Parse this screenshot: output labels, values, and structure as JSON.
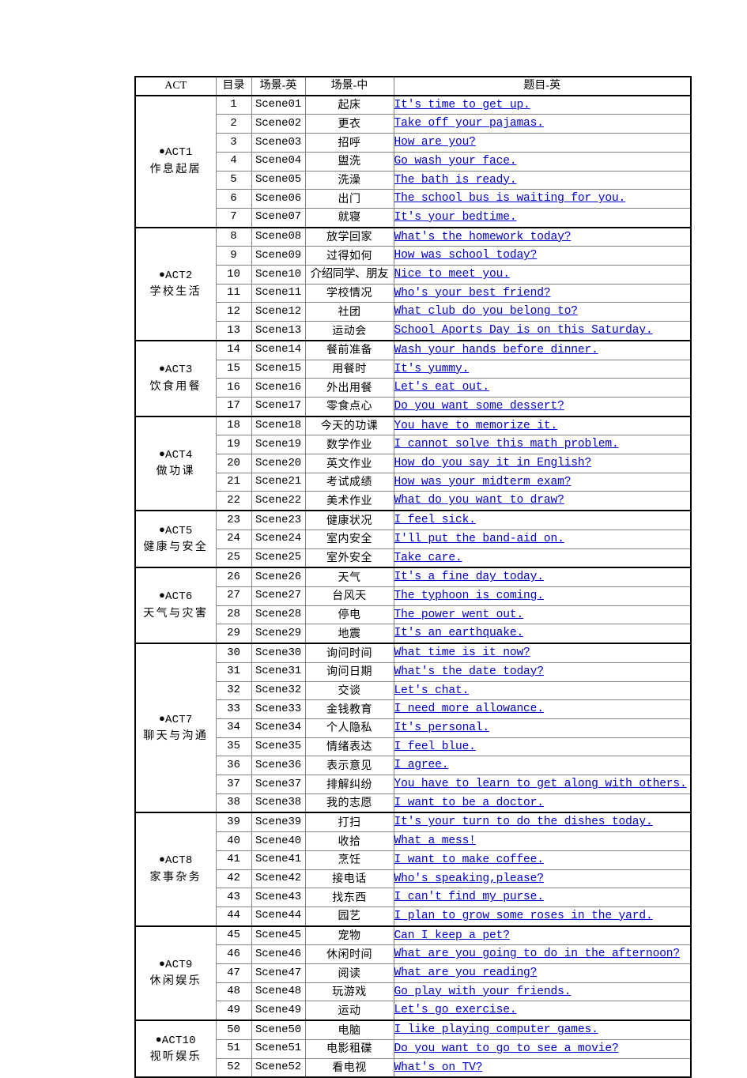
{
  "table": {
    "headers": {
      "act": "ACT",
      "index": "目录",
      "scene_en": "场景-英",
      "scene_zh": "场景-中",
      "title_en": "题目-英"
    },
    "groups": [
      {
        "code": "ACT1",
        "name": "作息起居",
        "rows": [
          {
            "index": "1",
            "scene_en": "Scene01",
            "scene_zh": "起床",
            "title_en": "It's time to get up."
          },
          {
            "index": "2",
            "scene_en": "Scene02",
            "scene_zh": "更衣",
            "title_en": "Take off your pajamas."
          },
          {
            "index": "3",
            "scene_en": "Scene03",
            "scene_zh": "招呼",
            "title_en": "How are you?"
          },
          {
            "index": "4",
            "scene_en": "Scene04",
            "scene_zh": "盥洗",
            "title_en": "Go wash your face."
          },
          {
            "index": "5",
            "scene_en": "Scene05",
            "scene_zh": "洗澡",
            "title_en": "The bath is ready."
          },
          {
            "index": "6",
            "scene_en": "Scene06",
            "scene_zh": "出门",
            "title_en": "The school bus is waiting for you."
          },
          {
            "index": "7",
            "scene_en": "Scene07",
            "scene_zh": "就寝",
            "title_en": "It's your bedtime."
          }
        ]
      },
      {
        "code": "ACT2",
        "name": "学校生活",
        "rows": [
          {
            "index": "8",
            "scene_en": "Scene08",
            "scene_zh": "放学回家",
            "title_en": "What's the homework today?"
          },
          {
            "index": "9",
            "scene_en": "Scene09",
            "scene_zh": "过得如何",
            "title_en": "How was school today?"
          },
          {
            "index": "10",
            "scene_en": "Scene10",
            "scene_zh": "介绍同学、朋友",
            "tight": true,
            "title_en": "Nice to meet you."
          },
          {
            "index": "11",
            "scene_en": "Scene11",
            "scene_zh": "学校情况",
            "title_en": "Who's your best friend?"
          },
          {
            "index": "12",
            "scene_en": "Scene12",
            "scene_zh": "社团",
            "title_en": "What club do you belong to?"
          },
          {
            "index": "13",
            "scene_en": "Scene13",
            "scene_zh": "运动会",
            "title_en": "School Aports Day is on this Saturday."
          }
        ]
      },
      {
        "code": "ACT3",
        "name": "饮食用餐",
        "rows": [
          {
            "index": "14",
            "scene_en": "Scene14",
            "scene_zh": "餐前准备",
            "title_en": "Wash your hands before dinner."
          },
          {
            "index": "15",
            "scene_en": "Scene15",
            "scene_zh": "用餐时",
            "title_en": "It's yummy."
          },
          {
            "index": "16",
            "scene_en": "Scene16",
            "scene_zh": "外出用餐",
            "title_en": "Let's eat out."
          },
          {
            "index": "17",
            "scene_en": "Scene17",
            "scene_zh": "零食点心",
            "title_en": "Do you want some dessert?"
          }
        ]
      },
      {
        "code": "ACT4",
        "name": "做功课",
        "rows": [
          {
            "index": "18",
            "scene_en": "Scene18",
            "scene_zh": "今天的功课",
            "title_en": "You have to memorize it."
          },
          {
            "index": "19",
            "scene_en": "Scene19",
            "scene_zh": "数学作业",
            "title_en": "I cannot solve this math problem."
          },
          {
            "index": "20",
            "scene_en": "Scene20",
            "scene_zh": "英文作业",
            "title_en": "How do you say it in English?"
          },
          {
            "index": "21",
            "scene_en": "Scene21",
            "scene_zh": "考试成绩",
            "title_en": "How was your midterm exam?"
          },
          {
            "index": "22",
            "scene_en": "Scene22",
            "scene_zh": "美术作业",
            "title_en": "What do you want to draw?"
          }
        ]
      },
      {
        "code": "ACT5",
        "name": "健康与安全",
        "rows": [
          {
            "index": "23",
            "scene_en": "Scene23",
            "scene_zh": "健康状况",
            "title_en": "I feel sick."
          },
          {
            "index": "24",
            "scene_en": "Scene24",
            "scene_zh": "室内安全",
            "title_en": "I'll put the band-aid on."
          },
          {
            "index": "25",
            "scene_en": "Scene25",
            "scene_zh": "室外安全",
            "title_en": "Take care."
          }
        ]
      },
      {
        "code": "ACT6",
        "name": "天气与灾害",
        "rows": [
          {
            "index": "26",
            "scene_en": "Scene26",
            "scene_zh": "天气",
            "title_en": "It's a fine day today."
          },
          {
            "index": "27",
            "scene_en": "Scene27",
            "scene_zh": "台风天",
            "title_en": "The typhoon is coming."
          },
          {
            "index": "28",
            "scene_en": "Scene28",
            "scene_zh": "停电",
            "title_en": "The power went out."
          },
          {
            "index": "29",
            "scene_en": "Scene29",
            "scene_zh": "地震",
            "title_en": "It's an earthquake."
          }
        ]
      },
      {
        "code": "ACT7",
        "name": "聊天与沟通",
        "rows": [
          {
            "index": "30",
            "scene_en": "Scene30",
            "scene_zh": "询问时间",
            "title_en": "What time is it now?"
          },
          {
            "index": "31",
            "scene_en": "Scene31",
            "scene_zh": "询问日期",
            "title_en": "What's the date today?"
          },
          {
            "index": "32",
            "scene_en": "Scene32",
            "scene_zh": "交谈",
            "title_en": "Let's chat."
          },
          {
            "index": "33",
            "scene_en": "Scene33",
            "scene_zh": "金钱教育",
            "title_en": "I need more allowance."
          },
          {
            "index": "34",
            "scene_en": "Scene34",
            "scene_zh": "个人隐私",
            "title_en": "It's personal."
          },
          {
            "index": "35",
            "scene_en": "Scene35",
            "scene_zh": "情绪表达",
            "title_en": "I feel blue."
          },
          {
            "index": "36",
            "scene_en": "Scene36",
            "scene_zh": "表示意见",
            "title_en": "I agree."
          },
          {
            "index": "37",
            "scene_en": "Scene37",
            "scene_zh": "排解纠纷",
            "title_en": "You have to learn to get along with others."
          },
          {
            "index": "38",
            "scene_en": "Scene38",
            "scene_zh": "我的志愿",
            "title_en": "I want to be a doctor."
          }
        ]
      },
      {
        "code": "ACT8",
        "name": "家事杂务",
        "rows": [
          {
            "index": "39",
            "scene_en": "Scene39",
            "scene_zh": "打扫",
            "title_en": "It's your turn to do the dishes today."
          },
          {
            "index": "40",
            "scene_en": "Scene40",
            "scene_zh": "收拾",
            "title_en": "What a mess!"
          },
          {
            "index": "41",
            "scene_en": "Scene41",
            "scene_zh": "烹饪",
            "title_en": "I want to make coffee."
          },
          {
            "index": "42",
            "scene_en": "Scene42",
            "scene_zh": "接电话",
            "title_en": "Who's speaking,please?"
          },
          {
            "index": "43",
            "scene_en": "Scene43",
            "scene_zh": "找东西",
            "title_en": "I can't find my purse."
          },
          {
            "index": "44",
            "scene_en": "Scene44",
            "scene_zh": "园艺",
            "title_en": "I plan to grow some roses in the yard."
          }
        ]
      },
      {
        "code": "ACT9",
        "name": "休闲娱乐",
        "rows": [
          {
            "index": "45",
            "scene_en": "Scene45",
            "scene_zh": "宠物",
            "title_en": "Can I keep a pet?"
          },
          {
            "index": "46",
            "scene_en": "Scene46",
            "scene_zh": "休闲时间",
            "title_en": "What are you going to do in the afternoon?"
          },
          {
            "index": "47",
            "scene_en": "Scene47",
            "scene_zh": "阅读",
            "title_en": "What are you reading?"
          },
          {
            "index": "48",
            "scene_en": "Scene48",
            "scene_zh": "玩游戏",
            "title_en": "Go play with your friends."
          },
          {
            "index": "49",
            "scene_en": "Scene49",
            "scene_zh": "运动",
            "title_en": "Let's go exercise."
          }
        ]
      },
      {
        "code": "ACT10",
        "name": "视听娱乐",
        "rows": [
          {
            "index": "50",
            "scene_en": "Scene50",
            "scene_zh": "电脑",
            "title_en": "I like playing computer games."
          },
          {
            "index": "51",
            "scene_en": "Scene51",
            "scene_zh": "电影租碟",
            "title_en": "Do you want to go to see a movie?"
          },
          {
            "index": "52",
            "scene_en": "Scene52",
            "scene_zh": "看电视",
            "title_en": "What's on TV?"
          }
        ]
      }
    ]
  },
  "colors": {
    "link": "#0000CC",
    "text": "#000000",
    "grid": "#808080",
    "outline": "#000000",
    "background": "#FFFFFF"
  }
}
